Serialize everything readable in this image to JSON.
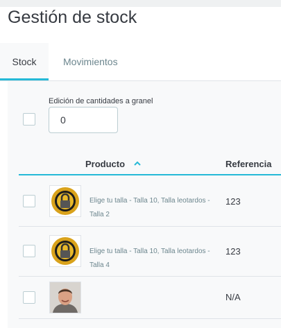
{
  "page": {
    "title": "Gestión de stock"
  },
  "tabs": [
    {
      "label": "Stock",
      "active": true
    },
    {
      "label": "Movimientos",
      "active": false
    }
  ],
  "bulk": {
    "label": "Edición de cantidades a granel",
    "value": "0"
  },
  "table": {
    "columns": {
      "product": "Producto",
      "reference": "Referencia"
    },
    "sort": {
      "column": "Producto",
      "direction": "ascending",
      "icon": "chevron-up-icon"
    },
    "rows": [
      {
        "name": "Elige tu talla - Talla 10, Talla leotardos - Talla 2",
        "reference": "123",
        "thumb": "gold-lock-seal-image"
      },
      {
        "name": "Elige tu talla - Talla 10, Talla leotardos - Talla 4",
        "reference": "123",
        "thumb": "gold-lock-seal-image"
      },
      {
        "name": "",
        "reference": "N/A",
        "thumb": "person-photo"
      }
    ]
  },
  "colors": {
    "accent": "#25b9d7",
    "text": "#363a41",
    "muted": "#6c868e",
    "border": "#dfe3e8",
    "panel": "#f8f9fa"
  }
}
